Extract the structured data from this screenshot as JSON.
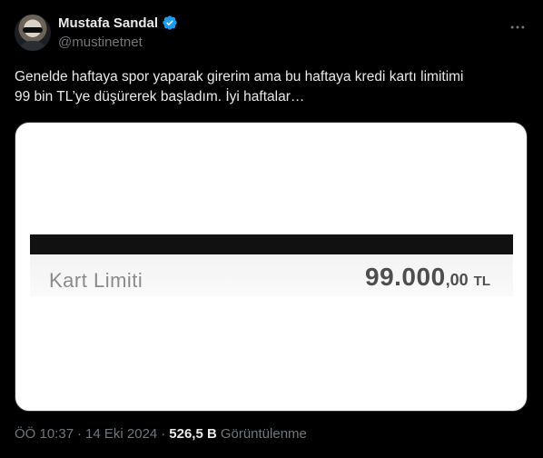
{
  "author": {
    "name": "Mustafa Sandal",
    "handle": "@mustinetnet",
    "verified_color": "#1d9bf0"
  },
  "tweet": {
    "text_line1": "Genelde haftaya spor yaparak girerim ama bu haftaya kredi kartı limitimi",
    "text_line2": "99 bin TL’ye düşürerek başladım. İyi haftalar…"
  },
  "media": {
    "label": "Kart Limiti",
    "amount_main": "99.000",
    "amount_decimal": ",00",
    "currency": "TL"
  },
  "meta": {
    "time": "ÖÖ 10:37",
    "separator": "·",
    "date": "14 Eki 2024",
    "views_count": "526,5 B",
    "views_label": "Görüntülenme"
  },
  "icons": {
    "more": "more-icon",
    "verified": "verified-badge-icon"
  }
}
